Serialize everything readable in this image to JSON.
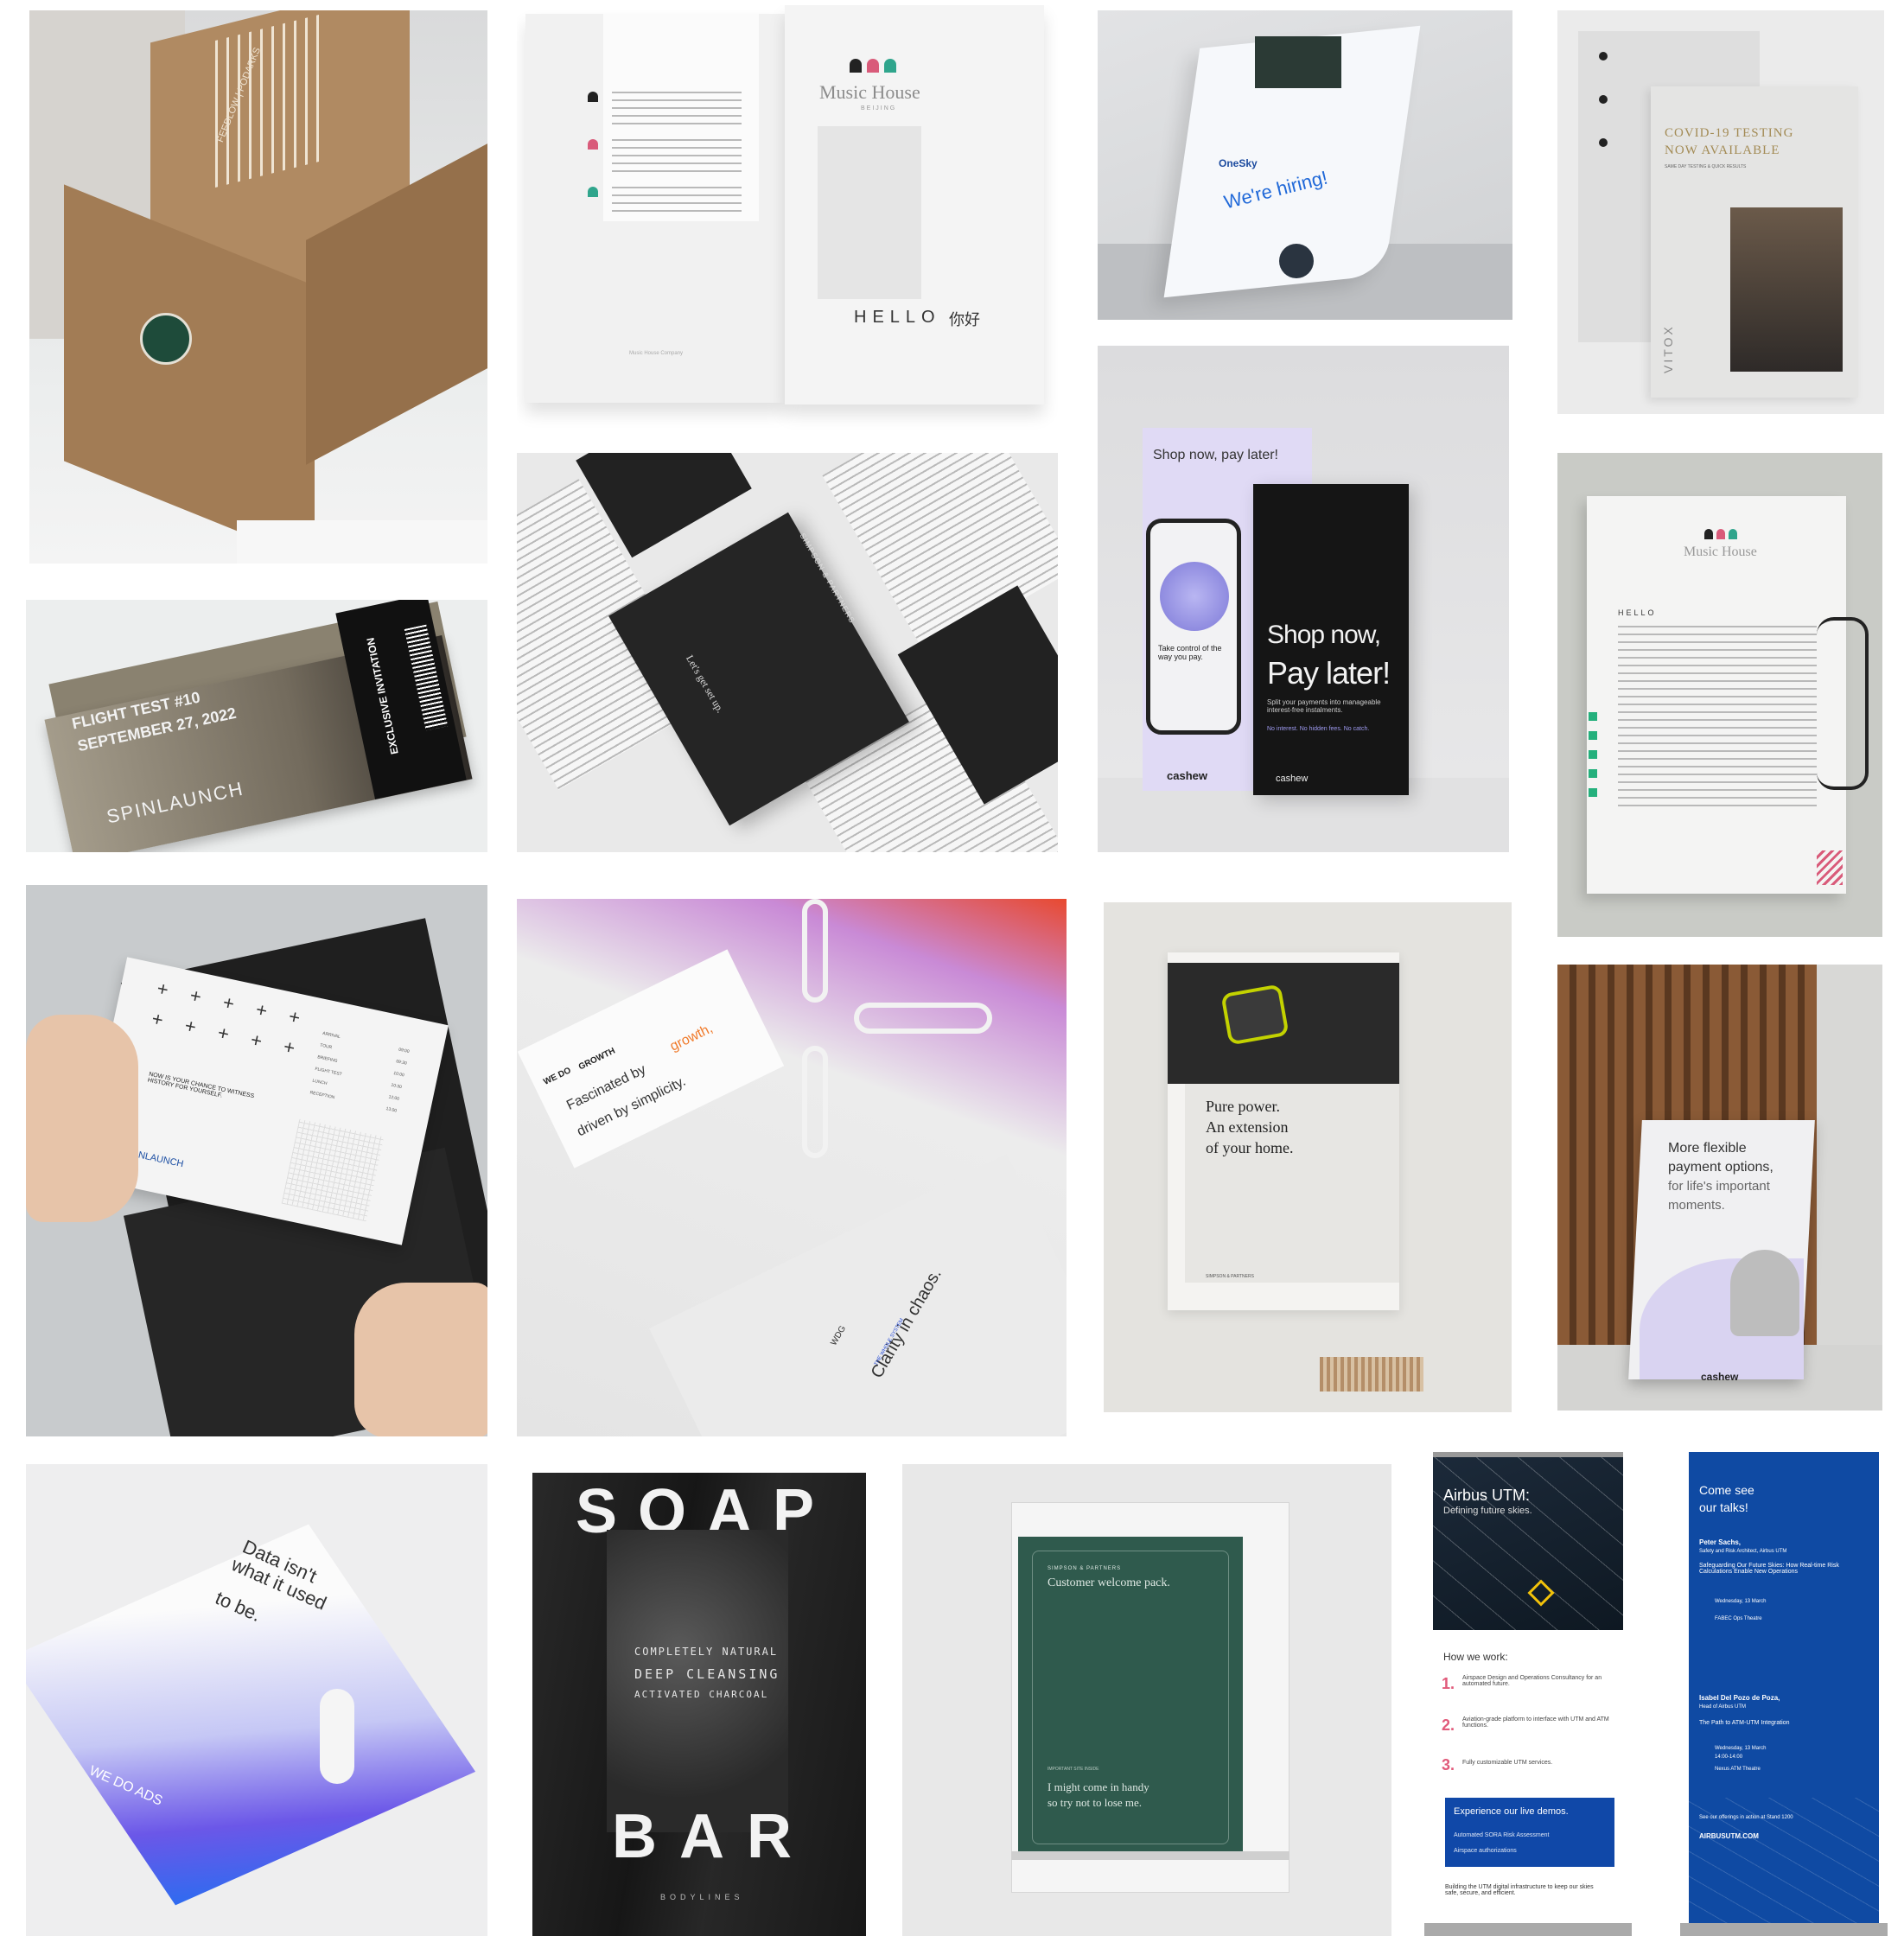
{
  "tiles": {
    "kraft_box": {
      "box_text": "FEEDLOW | PODARKS"
    },
    "music_book": {
      "brand": "Music House",
      "sub": "BEIJING",
      "hello": "HELLO",
      "nihao": "你好",
      "footer": "Music House Company"
    },
    "hiring": {
      "brand": "OneSky",
      "headline": "We're hiring!"
    },
    "covid": {
      "title1": "COVID-19 TESTING",
      "title2": "NOW AVAILABLE",
      "subtitle": "SAME DAY TESTING & QUICK RESULTS",
      "brand": "VITOX"
    },
    "ticket": {
      "line1": "FLIGHT TEST #10",
      "line2": "SEPTEMBER 27, 2022",
      "brand": "SPINLAUNCH",
      "stub": "EXCLUSIVE INVITATION"
    },
    "simpson_pack": {
      "brand": "SIMPSON & PARTNERS",
      "tagline": "Let's get set up."
    },
    "cashew_posters": {
      "small_headline": "Shop now, pay later!",
      "big1": "Shop now,",
      "big2": "Pay later!",
      "body": "Split your payments into manageable interest-free instalments.",
      "sub": "No interest. No hidden fees. No catch.",
      "phone_text": "Take control of the way you pay.",
      "brand": "cashew"
    },
    "music_letter": {
      "brand": "Music House",
      "greeting": "HELLO"
    },
    "invitation": {
      "question": "NOW IS YOUR CHANCE TO WITNESS HISTORY FOR YOURSELF.",
      "rows": [
        "ARRIVAL",
        "TOUR",
        "BRIEFING",
        "FLIGHT TEST",
        "LUNCH",
        "RECEPTION"
      ],
      "times": [
        "09:00",
        "09:30",
        "10:00",
        "10:30",
        "12:00",
        "13:00"
      ],
      "brand": "SPINLAUNCH"
    },
    "wedo_growth": {
      "brand_pre": "WE DO",
      "brand_word": "GROWTH",
      "line1": "Fascinated by ",
      "line1_accent": "growth,",
      "line2": "driven by simplicity.",
      "spine_brand": "WDG",
      "spine_text": "Clarity in chaos.",
      "spine_sub": "THE WHOLE SYSTEM"
    },
    "power": {
      "line1": "Pure power.",
      "line2": "An extension",
      "line3": "of your home.",
      "brand": "SIMPSON & PARTNERS"
    },
    "aframe": {
      "line1": "More flexible",
      "line2": "payment options,",
      "line3": "for life's important",
      "line4": "moments.",
      "brand": "cashew"
    },
    "data_ads": {
      "line1": "Data isn't",
      "line2": "what it used",
      "line3": "to be.",
      "brand": "WE DO ADS"
    },
    "soap": {
      "top": "SOAP",
      "bottom": "BAR",
      "l1": "COMPLETELY NATURAL",
      "l2": "DEEP CLEANSING",
      "l3": "ACTIVATED CHARCOAL",
      "footer": "BODYLINES"
    },
    "welcome": {
      "brand": "SIMPSON & PARTNERS",
      "title": "Customer welcome pack.",
      "small": "IMPORTANT SITE INSIDE",
      "note1": "I might come in handy",
      "note2": "so try not to lose me."
    },
    "airbus1": {
      "title": "Airbus UTM:",
      "subtitle": "Defining future skies.",
      "how": "How we work:",
      "items": [
        "Airspace Design and Operations Consultancy for an automated future.",
        "Aviation-grade platform to interface with UTM and ATM functions.",
        "Fully customizable UTM services."
      ],
      "demo": "Experience our live demos.",
      "demo1": "Automated SORA Risk Assessment",
      "demo2": "Airspace authorizations",
      "footer": "Building the UTM digital infrastructure to keep our skies safe, secure, and efficient."
    },
    "airbus2": {
      "title1": "Come see",
      "title2": "our talks!",
      "p1_name": "Peter Sachs,",
      "p1_role": "Safety and Risk Architect, Airbus UTM",
      "p1_talk": "Safeguarding Our Future Skies: How Real-time Risk Calculations Enable New Operations",
      "p1_date": "Wednesday, 13 March",
      "p1_place": "FABEC Ops Theatre",
      "p2_name": "Isabel Del Pozo de Poza,",
      "p2_role": "Head of Airbus UTM",
      "p2_talk": "The Path to ATM-UTM Integration",
      "p2_date": "Wednesday, 13 March",
      "p2_time": "14:00-14:00",
      "p2_place": "Nexus ATM Theatre",
      "cta": "See our offerings in action at Stand 1200",
      "url": "AIRBUSUTM.COM"
    }
  },
  "colors": {
    "kraft": "#a98560",
    "ink": "#1d1d1d",
    "airbus_blue": "#0f4aa3",
    "green": "#2f5a4d",
    "lilac": "#d9d3f1"
  }
}
